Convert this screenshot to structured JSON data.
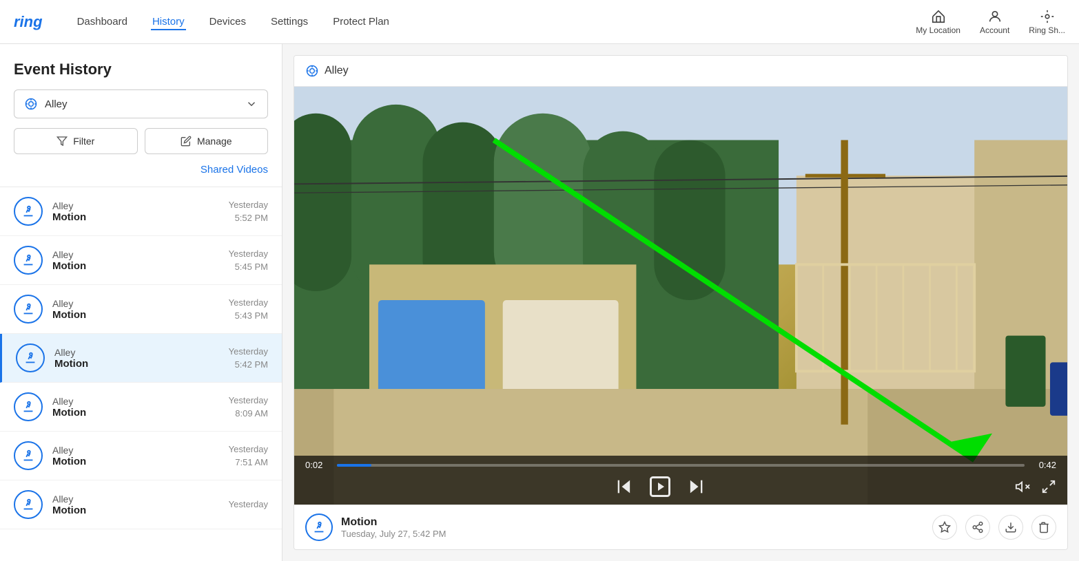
{
  "nav": {
    "logo": "ring",
    "items": [
      {
        "label": "Dashboard",
        "active": false
      },
      {
        "label": "History",
        "active": true
      },
      {
        "label": "Devices",
        "active": false
      },
      {
        "label": "Settings",
        "active": false
      },
      {
        "label": "Protect Plan",
        "active": false
      }
    ],
    "right_items": [
      {
        "label": "My Location",
        "icon": "home-icon"
      },
      {
        "label": "Account",
        "icon": "account-icon"
      },
      {
        "label": "Ring Sh...",
        "icon": "ring-icon"
      }
    ]
  },
  "sidebar": {
    "title": "Event History",
    "device_selector": {
      "label": "Alley",
      "icon": "camera-icon"
    },
    "filter_button": "Filter",
    "manage_button": "Manage",
    "shared_videos_link": "Shared Videos",
    "events": [
      {
        "id": 1,
        "device": "Alley",
        "type": "Motion",
        "day": "Yesterday",
        "time": "5:52 PM",
        "selected": false
      },
      {
        "id": 2,
        "device": "Alley",
        "type": "Motion",
        "day": "Yesterday",
        "time": "5:45 PM",
        "selected": false
      },
      {
        "id": 3,
        "device": "Alley",
        "type": "Motion",
        "day": "Yesterday",
        "time": "5:43 PM",
        "selected": false
      },
      {
        "id": 4,
        "device": "Alley",
        "type": "Motion",
        "day": "Yesterday",
        "time": "5:42 PM",
        "selected": true
      },
      {
        "id": 5,
        "device": "Alley",
        "type": "Motion",
        "day": "Yesterday",
        "time": "8:09 AM",
        "selected": false
      },
      {
        "id": 6,
        "device": "Alley",
        "type": "Motion",
        "day": "Yesterday",
        "time": "7:51 AM",
        "selected": false
      },
      {
        "id": 7,
        "device": "Alley",
        "type": "Motion",
        "day": "Yesterday",
        "time": "",
        "selected": false
      }
    ]
  },
  "video_panel": {
    "header_title": "Alley",
    "progress_current": "0:02",
    "progress_end": "0:42",
    "progress_percent": 5,
    "info": {
      "event_title": "Motion",
      "event_date": "Tuesday, July 27, 5:42 PM"
    },
    "actions": [
      {
        "label": "favorite",
        "icon": "star-icon"
      },
      {
        "label": "share",
        "icon": "share-icon"
      },
      {
        "label": "download",
        "icon": "download-icon"
      },
      {
        "label": "delete",
        "icon": "trash-icon"
      }
    ]
  }
}
